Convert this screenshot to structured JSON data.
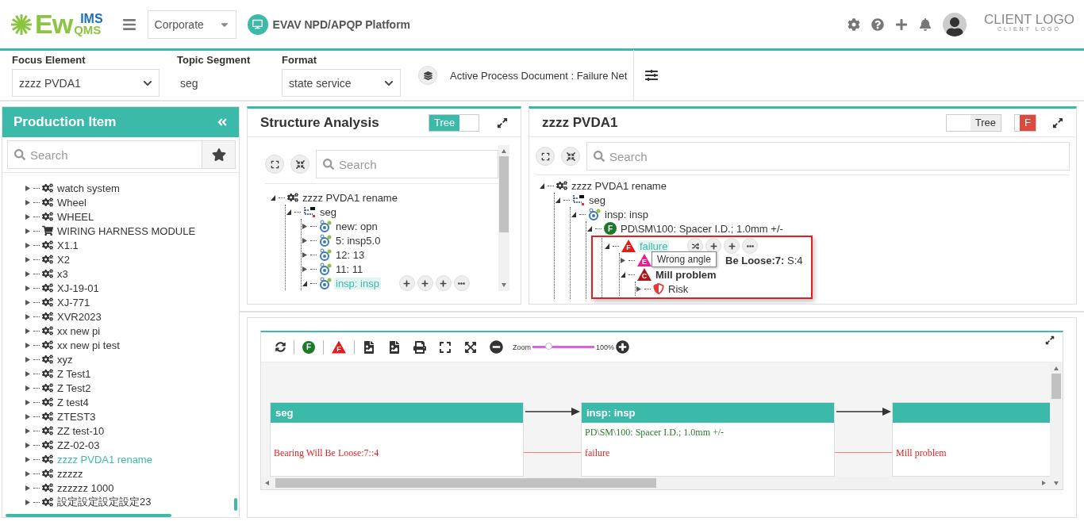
{
  "header": {
    "logo": {
      "main": "Ew",
      "top": "IMS",
      "bottom": "QMS"
    },
    "company": "Corporate",
    "platform": "EVAV NPD/APQP Platform",
    "client_logo": {
      "title": "CLIENT LOGO",
      "subtitle": "CLIENT LOGO"
    }
  },
  "filters": [
    {
      "kind": "select",
      "label": "Focus Element",
      "value": "zzzz PVDA1"
    },
    {
      "kind": "text",
      "label": "Topic Segment",
      "value": "seg"
    },
    {
      "kind": "select",
      "label": "Format",
      "value": "state service"
    }
  ],
  "active_document": "Active Process Document : Failure Net",
  "production_panel": {
    "title": "Production Item",
    "search_placeholder": "Search",
    "items": [
      {
        "label": "watch system",
        "kind": "gear",
        "expanded": false,
        "selected": false
      },
      {
        "label": "Wheel",
        "kind": "gear",
        "expanded": false,
        "selected": false
      },
      {
        "label": "WHEEL",
        "kind": "gear",
        "expanded": false,
        "selected": false
      },
      {
        "label": "WIRING HARNESS MODULE",
        "kind": "cart",
        "expanded": false,
        "selected": false
      },
      {
        "label": "X1.1",
        "kind": "gear",
        "expanded": false,
        "selected": false
      },
      {
        "label": "X2",
        "kind": "gear",
        "expanded": false,
        "selected": false
      },
      {
        "label": "x3",
        "kind": "gear",
        "expanded": false,
        "selected": false
      },
      {
        "label": "XJ-19-01",
        "kind": "gear",
        "expanded": false,
        "selected": false
      },
      {
        "label": "XJ-771",
        "kind": "gear",
        "expanded": false,
        "selected": false
      },
      {
        "label": "XVR2023",
        "kind": "gear",
        "expanded": false,
        "selected": false
      },
      {
        "label": "xx new pi",
        "kind": "gear",
        "expanded": false,
        "selected": false
      },
      {
        "label": "xx new pi test",
        "kind": "gear",
        "expanded": false,
        "selected": false
      },
      {
        "label": "xyz",
        "kind": "gear",
        "expanded": false,
        "selected": false
      },
      {
        "label": "Z Test1",
        "kind": "gear",
        "expanded": false,
        "selected": false
      },
      {
        "label": "Z Test2",
        "kind": "gear",
        "expanded": false,
        "selected": false
      },
      {
        "label": "Z test4",
        "kind": "gear",
        "expanded": false,
        "selected": false
      },
      {
        "label": "ZTEST3",
        "kind": "gear",
        "expanded": false,
        "selected": false
      },
      {
        "label": "ZZ test-10",
        "kind": "gear",
        "expanded": false,
        "selected": false
      },
      {
        "label": "ZZ-02-03",
        "kind": "gear",
        "expanded": false,
        "selected": false
      },
      {
        "label": "zzzz PVDA1 rename",
        "kind": "gear",
        "expanded": false,
        "selected": true
      },
      {
        "label": "zzzzz",
        "kind": "gear",
        "expanded": false,
        "selected": false
      },
      {
        "label": "zzzzzz 1000",
        "kind": "gear",
        "expanded": false,
        "selected": false
      },
      {
        "label": "設定設定設定設定23",
        "kind": "gear",
        "expanded": false,
        "selected": false
      }
    ]
  },
  "structure_panel": {
    "title": "Structure Analysis",
    "toggle": {
      "label": "Tree",
      "on": true
    },
    "search_placeholder": "Search",
    "tree": {
      "label": "zzzz PVDA1 rename",
      "kind": "gear",
      "expanded": true,
      "selected": false,
      "children": [
        {
          "label": "seg",
          "kind": "segment",
          "expanded": true,
          "selected": false,
          "children": [
            {
              "label": "new: opn",
              "kind": "process",
              "expanded": false,
              "selected": false
            },
            {
              "label": "5: insp5.0",
              "kind": "process",
              "expanded": false,
              "selected": false
            },
            {
              "label": "12: 13",
              "kind": "process",
              "expanded": false,
              "selected": false
            },
            {
              "label": "11: 11",
              "kind": "process",
              "expanded": false,
              "selected": false
            },
            {
              "label": "insp: insp",
              "kind": "process",
              "expanded": true,
              "selected": true,
              "hovered": true
            }
          ]
        }
      ]
    }
  },
  "net_panel": {
    "title": "zzzz PVDA1",
    "toggle": {
      "label": "Tree",
      "on": false
    },
    "f_toggle": {
      "label": "F",
      "on": true
    },
    "search_placeholder": "Search",
    "tree": {
      "label": "zzzz PVDA1 rename",
      "kind": "gear",
      "expanded": true,
      "selected": false,
      "children": [
        {
          "label": "seg",
          "kind": "segment",
          "expanded": true,
          "selected": false,
          "children": [
            {
              "label": "insp: insp",
              "kind": "process",
              "expanded": true,
              "selected": false,
              "children": [
                {
                  "label": "PD\\SM\\100: Spacer I.D.; 1.0mm +/-",
                  "kind": "function",
                  "badge": "F",
                  "expanded": true,
                  "selected": false,
                  "children": [
                    {
                      "label": "failure",
                      "kind": "failure",
                      "badge": "F",
                      "expanded": true,
                      "selected": true,
                      "framed": true,
                      "tooltip": "Wrong angle",
                      "hovered": true,
                      "children": [
                        {
                          "label": "**Be Loose:7:** S:4",
                          "kind": "effect",
                          "badge": "E",
                          "expanded": false,
                          "selected": false
                        },
                        {
                          "label": "Mill problem",
                          "kind": "cause",
                          "badge": "C",
                          "expanded": true,
                          "selected": false,
                          "children": [
                            {
                              "label": "Risk",
                              "kind": "risk",
                              "expanded": false,
                              "selected": false
                            }
                          ]
                        }
                      ]
                    }
                  ]
                }
              ]
            }
          ]
        }
      ]
    }
  },
  "diagram_panel": {
    "toolbar": {
      "zoom_label": "Zoom",
      "zoom": {
        "level": 0.25
      },
      "zoom_reading": "100%",
      "f_badge": "F",
      "failure_badge": "F"
    },
    "columns": [
      {
        "title": "seg",
        "items": [
          {
            "kind": "effect",
            "text": "Bearing Will Be Loose:7::4"
          }
        ]
      },
      {
        "title": "insp: insp",
        "items": [
          {
            "kind": "function",
            "text": "PD\\SM\\100: Spacer I.D.; 1.0mm +/-"
          },
          {
            "kind": "failure",
            "text": "failure"
          }
        ]
      },
      {
        "items": [
          {
            "kind": "cause",
            "text": "Mill problem"
          }
        ]
      }
    ]
  }
}
